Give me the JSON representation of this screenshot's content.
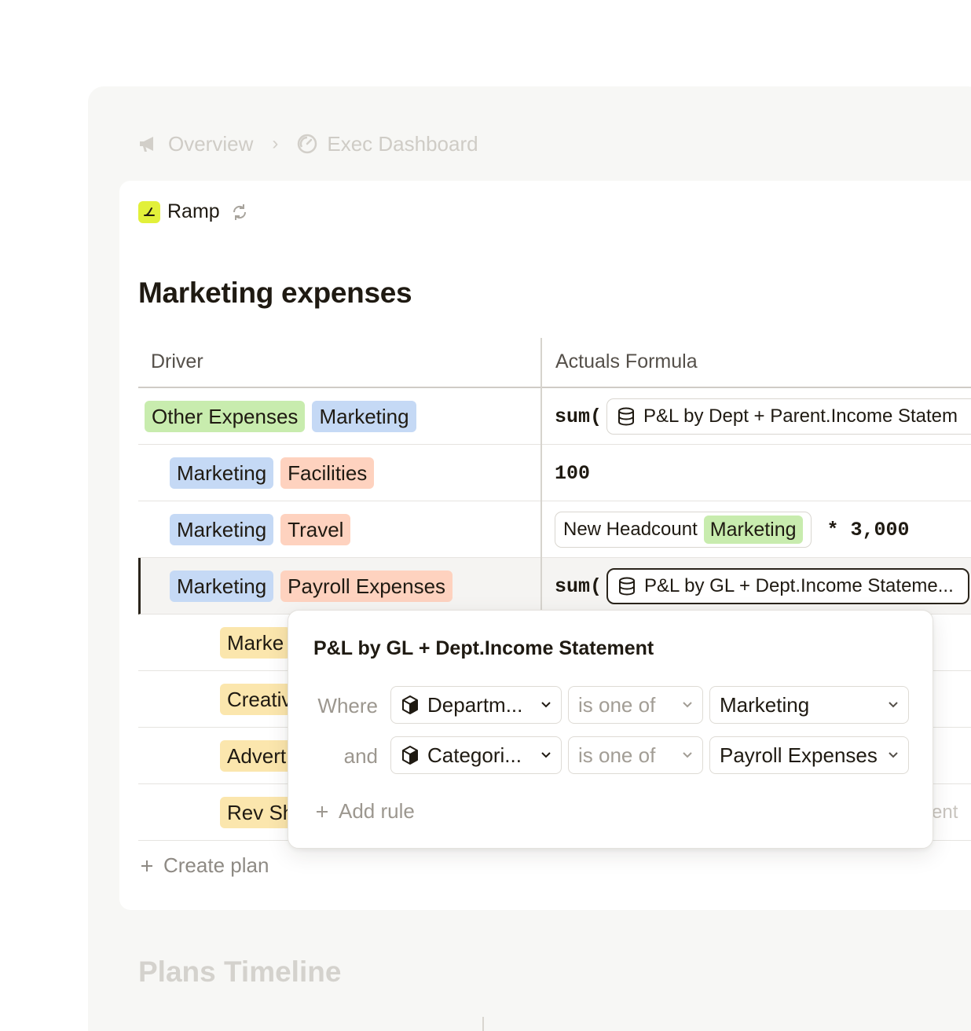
{
  "breadcrumb": {
    "items": [
      {
        "label": "Overview",
        "icon": "megaphone-icon"
      },
      {
        "label": "Exec Dashboard",
        "icon": "gauge-icon"
      }
    ],
    "separator": "›"
  },
  "brand": {
    "name": "Ramp",
    "logo_color": "#e2f03a"
  },
  "page": {
    "title": "Marketing expenses"
  },
  "table": {
    "headers": {
      "driver": "Driver",
      "formula": "Actuals Formula"
    },
    "rows": [
      {
        "tags": [
          "Other Expenses",
          "Marketing"
        ],
        "formula_prefix": "sum(",
        "formula_ref": "P&L by Dept + Parent.Income Statem"
      },
      {
        "tags": [
          "Marketing",
          "Facilities"
        ],
        "formula_value": "100"
      },
      {
        "tags": [
          "Marketing",
          "Travel"
        ],
        "formula_ref_label": "New Headcount",
        "formula_ref_tag": "Marketing",
        "formula_suffix": "* 3,000"
      },
      {
        "tags": [
          "Marketing",
          "Payroll Expenses"
        ],
        "formula_prefix": "sum(",
        "formula_ref": "P&L by GL + Dept.Income Stateme..."
      },
      {
        "tags": [
          "Marke"
        ]
      },
      {
        "tags": [
          "Creativ"
        ]
      },
      {
        "tags": [
          "Advert"
        ]
      },
      {
        "tags": [
          "Rev Sh"
        ],
        "formula_partial": "ent"
      }
    ]
  },
  "create_plan": {
    "label": "Create plan"
  },
  "plans_timeline": {
    "title": "Plans Timeline"
  },
  "popover": {
    "title": "P&L by GL + Dept.Income Statement",
    "rules": [
      {
        "label": "Where",
        "field": "Departm...",
        "operator": "is one of",
        "value": "Marketing"
      },
      {
        "label": "and",
        "field": "Categori...",
        "operator": "is one of",
        "value": "Payroll Expenses"
      }
    ],
    "add_rule_label": "Add rule"
  },
  "colors": {
    "tag_green": "#c8ecae",
    "tag_blue": "#c5d9f5",
    "tag_peach": "#fed2bf",
    "tag_yellow": "#fbe6ad",
    "text_primary": "#1f1a12"
  }
}
